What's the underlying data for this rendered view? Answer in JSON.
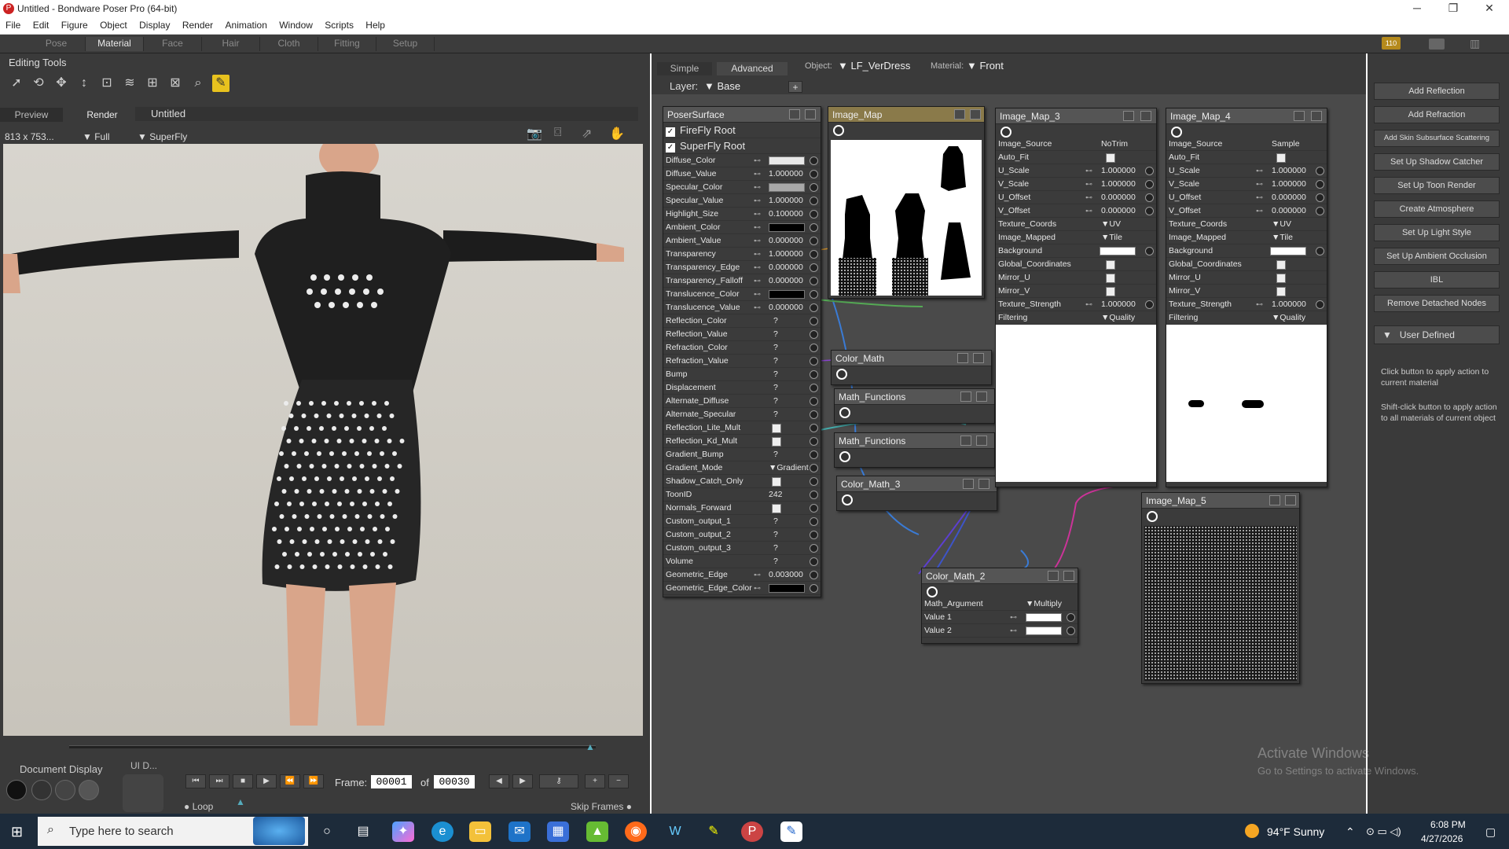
{
  "window": {
    "title": "Untitled - Bondware Poser Pro  (64-bit)",
    "controls": [
      "─",
      "❐",
      "✕"
    ]
  },
  "menu": [
    "File",
    "Edit",
    "Figure",
    "Object",
    "Display",
    "Render",
    "Animation",
    "Window",
    "Scripts",
    "Help"
  ],
  "rooms": [
    {
      "label": "Pose",
      "active": false
    },
    {
      "label": "Material",
      "active": true
    },
    {
      "label": "Face",
      "active": false
    },
    {
      "label": "Hair",
      "active": false
    },
    {
      "label": "Cloth",
      "active": false
    },
    {
      "label": "Fitting",
      "active": false
    },
    {
      "label": "Setup",
      "active": false
    }
  ],
  "room_badge": "110",
  "editing_tools": {
    "label": "Editing Tools"
  },
  "view_tabs": {
    "preview": "Preview",
    "render": "Render",
    "doc": "Untitled"
  },
  "viewport": {
    "size": "813 x 753...",
    "quality": "Full",
    "engine": "SuperFly"
  },
  "document_display": {
    "label": "Document Display",
    "ui": "UI D..."
  },
  "playback": {
    "frame_label": "Frame:",
    "frame": "00001",
    "of_label": "of",
    "total": "00030",
    "loop": "Loop",
    "skip": "Skip Frames"
  },
  "material_tabs": {
    "simple": "Simple",
    "advanced": "Advanced",
    "object_label": "Object:",
    "object": "LF_VerDress",
    "material_label": "Material:",
    "material": "Front",
    "layer_label": "Layer:",
    "layer": "Base",
    "add": "+"
  },
  "poser_surface": {
    "title": "PoserSurface",
    "roots": [
      "FireFly Root",
      "SuperFly Root"
    ],
    "params": [
      {
        "name": "Diffuse_Color",
        "kind": "swatch",
        "color": "#e8e8e8"
      },
      {
        "name": "Diffuse_Value",
        "kind": "value",
        "value": "1.000000"
      },
      {
        "name": "Specular_Color",
        "kind": "swatch",
        "color": "#a8a8a8"
      },
      {
        "name": "Specular_Value",
        "kind": "value",
        "value": "1.000000"
      },
      {
        "name": "Highlight_Size",
        "kind": "value",
        "value": "0.100000"
      },
      {
        "name": "Ambient_Color",
        "kind": "swatch",
        "color": "#000000"
      },
      {
        "name": "Ambient_Value",
        "kind": "value",
        "value": "0.000000"
      },
      {
        "name": "Transparency",
        "kind": "value",
        "value": "1.000000"
      },
      {
        "name": "Transparency_Edge",
        "kind": "value",
        "value": "0.000000"
      },
      {
        "name": "Transparency_Falloff",
        "kind": "value",
        "value": "0.000000"
      },
      {
        "name": "Translucence_Color",
        "kind": "swatch",
        "color": "#000000"
      },
      {
        "name": "Translucence_Value",
        "kind": "value",
        "value": "0.000000"
      },
      {
        "name": "Reflection_Color",
        "kind": "value",
        "value": "?"
      },
      {
        "name": "Reflection_Value",
        "kind": "value",
        "value": "?"
      },
      {
        "name": "Refraction_Color",
        "kind": "value",
        "value": "?"
      },
      {
        "name": "Refraction_Value",
        "kind": "value",
        "value": "?"
      },
      {
        "name": "Bump",
        "kind": "value",
        "value": "?"
      },
      {
        "name": "Displacement",
        "kind": "value",
        "value": "?"
      },
      {
        "name": "Alternate_Diffuse",
        "kind": "value",
        "value": "?"
      },
      {
        "name": "Alternate_Specular",
        "kind": "value",
        "value": "?"
      },
      {
        "name": "Reflection_Lite_Mult",
        "kind": "check"
      },
      {
        "name": "Reflection_Kd_Mult",
        "kind": "check"
      },
      {
        "name": "Gradient_Bump",
        "kind": "value",
        "value": "?"
      },
      {
        "name": "Gradient_Mode",
        "kind": "value",
        "value": "▼Gradient B"
      },
      {
        "name": "Shadow_Catch_Only",
        "kind": "check"
      },
      {
        "name": "ToonID",
        "kind": "value",
        "value": "242"
      },
      {
        "name": "Normals_Forward",
        "kind": "check"
      },
      {
        "name": "Custom_output_1",
        "kind": "value",
        "value": "?"
      },
      {
        "name": "Custom_output_2",
        "kind": "value",
        "value": "?"
      },
      {
        "name": "Custom_output_3",
        "kind": "value",
        "value": "?"
      },
      {
        "name": "Volume",
        "kind": "value",
        "value": "?"
      },
      {
        "name": "Geometric_Edge",
        "kind": "value",
        "value": "0.003000"
      },
      {
        "name": "Geometric_Edge_Color",
        "kind": "swatch",
        "color": "#000000"
      }
    ]
  },
  "nodes": {
    "image_map": "Image_Map",
    "color_math": "Color_Math",
    "math_functions_1": "Math_Functions",
    "math_functions_2": "Math_Functions",
    "color_math_3": "Color_Math_3",
    "image_map_5": "Image_Map_5",
    "color_math_2": {
      "title": "Color_Math_2",
      "params": [
        {
          "name": "Math_Argument",
          "value": "▼Multiply"
        },
        {
          "name": "Value 1",
          "value": ""
        },
        {
          "name": "Value 2",
          "value": ""
        }
      ]
    },
    "image_map_3": {
      "title": "Image_Map_3",
      "params": [
        {
          "name": "Image_Source",
          "value": "NoTrim"
        },
        {
          "name": "Auto_Fit",
          "value": "",
          "check": true
        },
        {
          "name": "U_Scale",
          "value": "1.000000"
        },
        {
          "name": "V_Scale",
          "value": "1.000000"
        },
        {
          "name": "U_Offset",
          "value": "0.000000"
        },
        {
          "name": "V_Offset",
          "value": "0.000000"
        },
        {
          "name": "Texture_Coords",
          "value": "▼UV"
        },
        {
          "name": "Image_Mapped",
          "value": "▼Tile"
        },
        {
          "name": "Background",
          "value": "",
          "swatch": true
        },
        {
          "name": "Global_Coordinates",
          "value": "",
          "check": true
        },
        {
          "name": "Mirror_U",
          "value": "",
          "check": true
        },
        {
          "name": "Mirror_V",
          "value": "",
          "check": true
        },
        {
          "name": "Texture_Strength",
          "value": "1.000000"
        },
        {
          "name": "Filtering",
          "value": "▼Quality"
        }
      ]
    },
    "image_map_4": {
      "title": "Image_Map_4",
      "params": [
        {
          "name": "Image_Source",
          "value": "Sample"
        },
        {
          "name": "Auto_Fit",
          "value": "",
          "check": true
        },
        {
          "name": "U_Scale",
          "value": "1.000000"
        },
        {
          "name": "V_Scale",
          "value": "1.000000"
        },
        {
          "name": "U_Offset",
          "value": "0.000000"
        },
        {
          "name": "V_Offset",
          "value": "0.000000"
        },
        {
          "name": "Texture_Coords",
          "value": "▼UV"
        },
        {
          "name": "Image_Mapped",
          "value": "▼Tile"
        },
        {
          "name": "Background",
          "value": "",
          "swatch": true
        },
        {
          "name": "Global_Coordinates",
          "value": "",
          "check": true
        },
        {
          "name": "Mirror_U",
          "value": "",
          "check": true
        },
        {
          "name": "Mirror_V",
          "value": "",
          "check": true
        },
        {
          "name": "Texture_Strength",
          "value": "1.000000"
        },
        {
          "name": "Filtering",
          "value": "▼Quality"
        }
      ]
    }
  },
  "wizards": [
    "Add Reflection",
    "Add Refraction",
    "Add Skin Subsurface Scattering",
    "Set Up Shadow Catcher",
    "Set Up Toon Render",
    "Create Atmosphere",
    "Set Up Light Style",
    "Set Up Ambient Occlusion",
    "IBL",
    "Remove Detached Nodes"
  ],
  "user_defined": "User Defined",
  "help_text": [
    "Click button to apply action to current material",
    "Shift-click button to apply action to all materials of current object"
  ],
  "watermark": {
    "title": "Activate Windows",
    "sub": "Go to Settings to activate Windows."
  },
  "taskbar": {
    "search": "Type here to search",
    "weather": "94°F  Sunny",
    "time": "6:08 PM",
    "date": "4/27/2026"
  }
}
